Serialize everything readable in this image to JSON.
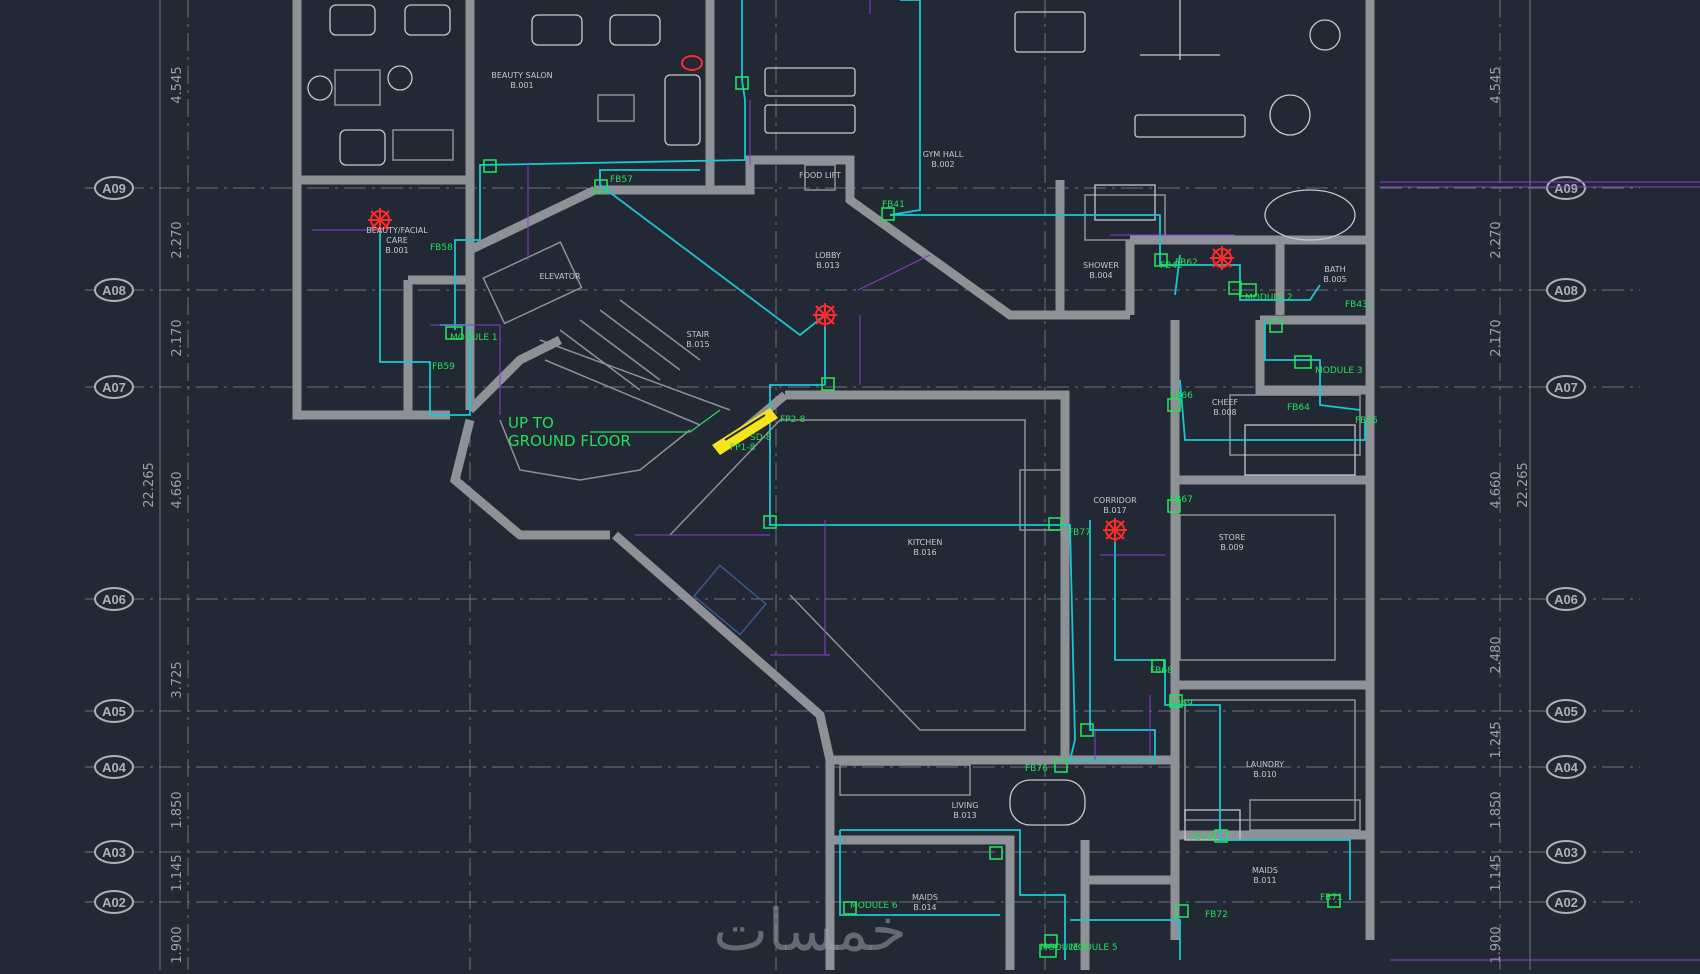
{
  "colors": {
    "background": "#222834",
    "wall": "#8e9196",
    "duct": "#18c7d1",
    "dimension": "#8a3fd1",
    "tag": "#22e05a",
    "sensor": "#ff2a2a",
    "grid_line": "#6f747c",
    "room_text": "#c6c8cc",
    "bubble": "#aeb2b8",
    "highlight": "#f5e51a"
  },
  "grid": {
    "rows": [
      {
        "label": "A09"
      },
      {
        "label": "A08"
      },
      {
        "label": "A07"
      },
      {
        "label": "A06"
      },
      {
        "label": "A05"
      },
      {
        "label": "A04"
      },
      {
        "label": "A03"
      },
      {
        "label": "A02"
      }
    ],
    "left_dims": [
      "4.545",
      "2.270",
      "2.170",
      "4.660",
      "3.725",
      "1.850",
      "1.145",
      "1.900"
    ],
    "left_total": "22.265",
    "right_dims": [
      "4.545",
      "2.270",
      "2.170",
      "4.660",
      "2.480",
      "1.245",
      "1.850",
      "1.145",
      "1.900"
    ],
    "right_total": "22.265"
  },
  "rooms": [
    {
      "name": "BEAUTY SALON",
      "code": "B.001"
    },
    {
      "name": "BEAUTY/FACIAL",
      "name2": "CARE",
      "code": "B.001"
    },
    {
      "name": "GYM HALL",
      "code": "B.002"
    },
    {
      "name": "LOBBY",
      "code": "B.013"
    },
    {
      "name": "STAIR",
      "code": "B.015"
    },
    {
      "name": "ELEVATOR",
      "code": ""
    },
    {
      "name": "FOOD LIFT",
      "code": ""
    },
    {
      "name": "SHOWER",
      "code": "B.004"
    },
    {
      "name": "BATH",
      "code": "B.005"
    },
    {
      "name": "CHEEF",
      "code": "B.008"
    },
    {
      "name": "KITCHEN",
      "code": "B.016"
    },
    {
      "name": "CORRIDOR",
      "code": "B.017"
    },
    {
      "name": "STORE",
      "code": "B.009"
    },
    {
      "name": "LIVING",
      "code": "B.013"
    },
    {
      "name": "LAUNDRY",
      "code": "B.010"
    },
    {
      "name": "MAIDS",
      "code": "B.014"
    },
    {
      "name": "MAIDS",
      "code": "B.011"
    }
  ],
  "annotation": {
    "line1": "UP TO",
    "line2": "GROUND FLOOR"
  },
  "tags": [
    "FB57",
    "FB58",
    "FB59",
    "FB41",
    "FB42",
    "FB43",
    "FB64",
    "FB65",
    "FB66",
    "FB67",
    "FB68",
    "FB69",
    "FB70",
    "FB71",
    "FB72",
    "FB76",
    "FB77",
    "FB62",
    "FP2-8",
    "FP1-8",
    "SD-8",
    "MODULE 1",
    "MODULE 2",
    "MODULE 3",
    "MODULE 4",
    "MODULE 5",
    "MODULE 6"
  ],
  "icons": [
    "smoke-detector-icon",
    "fire-damper-icon",
    "gym-equipment-icon",
    "salon-chair-icon",
    "bed-icon"
  ],
  "watermark": "خمسات"
}
